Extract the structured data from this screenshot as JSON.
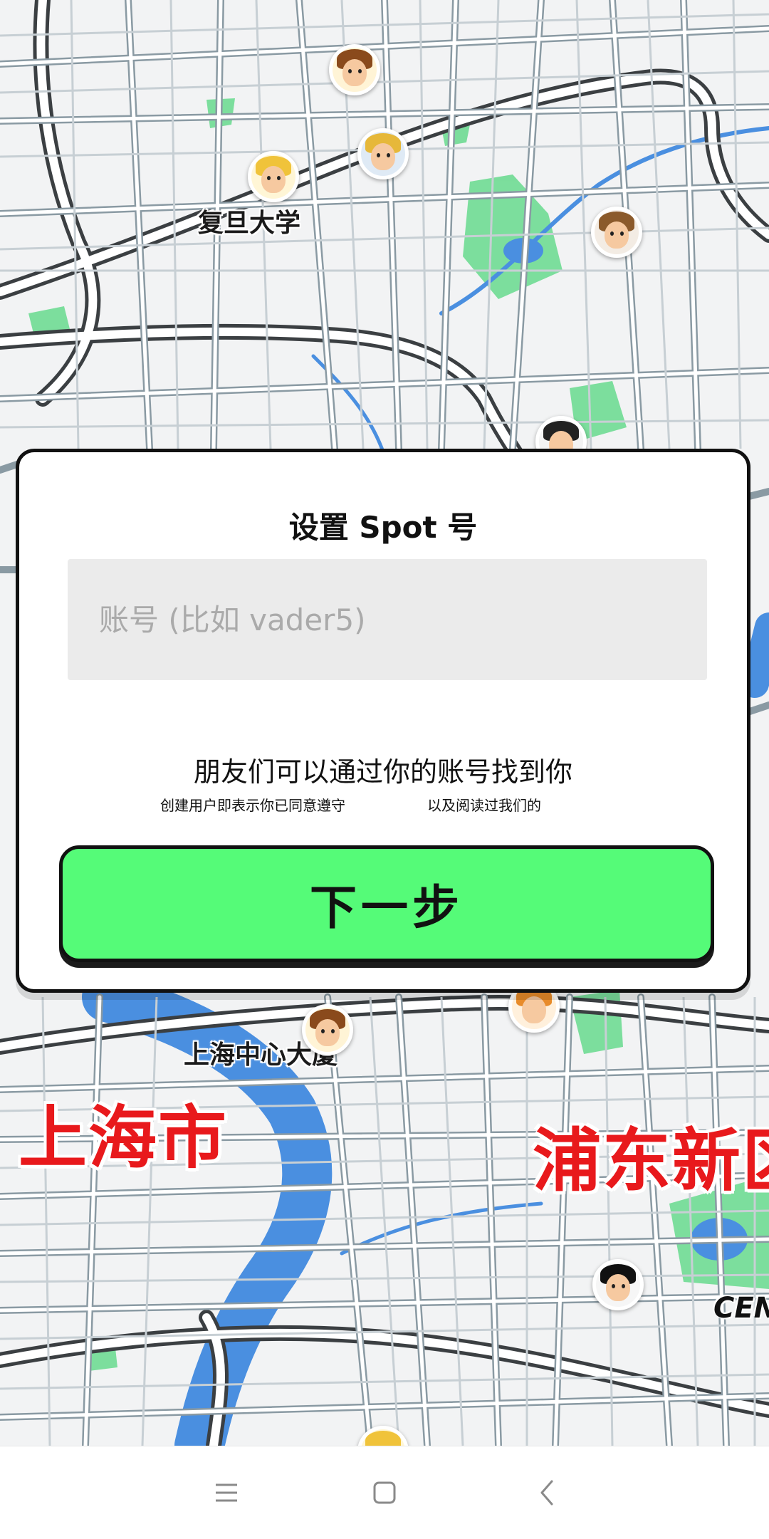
{
  "map": {
    "poi_labels": {
      "fudan": "复旦大学",
      "shanghai_center": "上海中心大厦"
    },
    "district_labels": {
      "shanghai": "上海市",
      "pudong": "浦东新区"
    },
    "en_label": "CEN",
    "colors": {
      "road_casing": "#3b3f42",
      "road_fill": "#ffffff",
      "water": "#4a90e2",
      "park": "#5fd68a",
      "district_text": "#e8191c"
    },
    "avatars": [
      {
        "name": "avatar-headphones-boy-icon"
      },
      {
        "name": "avatar-blonde-girl-icon"
      },
      {
        "name": "avatar-blonde-girl-2-icon"
      },
      {
        "name": "avatar-glasses-man-icon"
      },
      {
        "name": "avatar-dark-hair-woman-icon"
      },
      {
        "name": "avatar-headphones-boy-2-icon"
      },
      {
        "name": "avatar-orange-hair-girl-icon"
      },
      {
        "name": "avatar-black-hair-man-icon"
      }
    ]
  },
  "dialog": {
    "title": "设置 Spot 号",
    "input": {
      "value": "",
      "placeholder": "账号 (比如 vader5)"
    },
    "hint": "朋友们可以通过你的账号找到你",
    "terms_part1": "创建用户即表示你已同意遵守",
    "terms_part2": "以及阅读过我们的",
    "next_button": "下一步",
    "colors": {
      "button_bg": "#55fb78",
      "input_bg": "#ebebeb"
    }
  },
  "navbar": {
    "icons": [
      "menu-icon",
      "home-square-icon",
      "back-chevron-icon"
    ]
  }
}
